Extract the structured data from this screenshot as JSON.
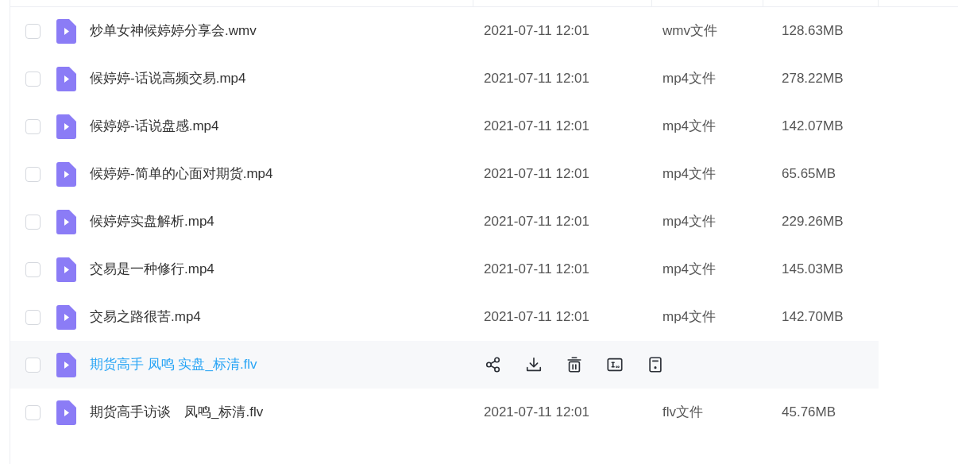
{
  "files": [
    {
      "name": "炒单女神候婷婷分享会.wmv",
      "time": "2021-07-11 12:01",
      "type": "wmv文件",
      "size": "128.63MB",
      "checked": false,
      "hovered": false
    },
    {
      "name": "候婷婷-话说高频交易.mp4",
      "time": "2021-07-11 12:01",
      "type": "mp4文件",
      "size": "278.22MB",
      "checked": false,
      "hovered": false
    },
    {
      "name": "候婷婷-话说盘感.mp4",
      "time": "2021-07-11 12:01",
      "type": "mp4文件",
      "size": "142.07MB",
      "checked": false,
      "hovered": false
    },
    {
      "name": "候婷婷-简单的心面对期货.mp4",
      "time": "2021-07-11 12:01",
      "type": "mp4文件",
      "size": "65.65MB",
      "checked": false,
      "hovered": false
    },
    {
      "name": "候婷婷实盘解析.mp4",
      "time": "2021-07-11 12:01",
      "type": "mp4文件",
      "size": "229.26MB",
      "checked": false,
      "hovered": false
    },
    {
      "name": "交易是一种修行.mp4",
      "time": "2021-07-11 12:01",
      "type": "mp4文件",
      "size": "145.03MB",
      "checked": false,
      "hovered": false
    },
    {
      "name": "交易之路很苦.mp4",
      "time": "2021-07-11 12:01",
      "type": "mp4文件",
      "size": "142.70MB",
      "checked": false,
      "hovered": false
    },
    {
      "name": "期货高手 凤鸣 实盘_标清.flv",
      "checked": false,
      "hovered": true
    },
    {
      "name": "期货高手访谈　凤鸣_标清.flv",
      "time": "2021-07-11 12:01",
      "type": "flv文件",
      "size": "45.76MB",
      "checked": false,
      "hovered": false
    }
  ]
}
